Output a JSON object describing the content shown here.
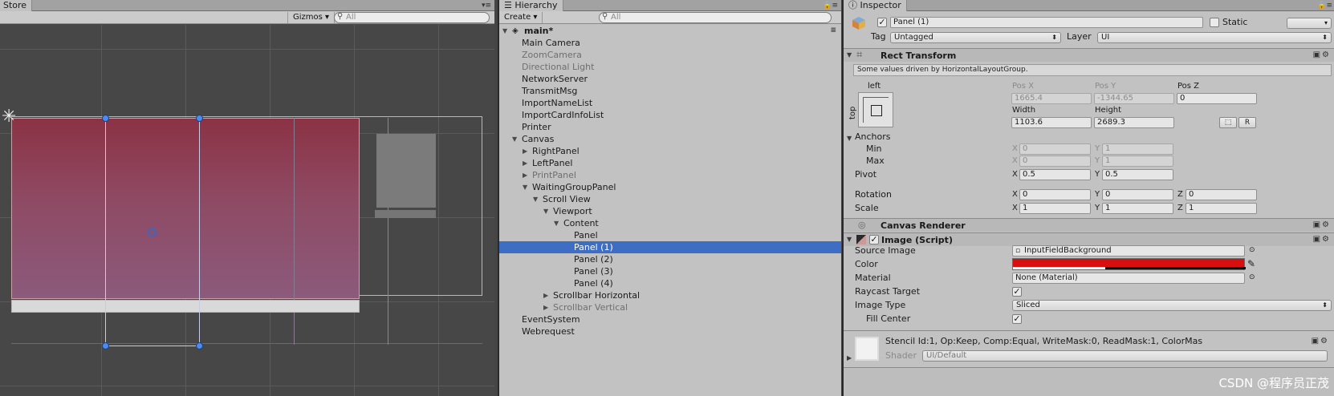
{
  "scene": {
    "tab_label": "Store",
    "gizmos_label": "Gizmos ▾",
    "search_placeholder": "All"
  },
  "hierarchy": {
    "tab_label": "Hierarchy",
    "create_label": "Create ▾",
    "search_placeholder": "All",
    "scene_name": "main*",
    "items": [
      {
        "label": "Main Camera",
        "depth": 0,
        "arrow": "",
        "dim": false,
        "selected": false
      },
      {
        "label": "ZoomCamera",
        "depth": 0,
        "arrow": "",
        "dim": true,
        "selected": false
      },
      {
        "label": "Directional Light",
        "depth": 0,
        "arrow": "",
        "dim": true,
        "selected": false
      },
      {
        "label": "NetworkServer",
        "depth": 0,
        "arrow": "",
        "dim": false,
        "selected": false
      },
      {
        "label": "TransmitMsg",
        "depth": 0,
        "arrow": "",
        "dim": false,
        "selected": false
      },
      {
        "label": "ImportNameList",
        "depth": 0,
        "arrow": "",
        "dim": false,
        "selected": false
      },
      {
        "label": "ImportCardInfoList",
        "depth": 0,
        "arrow": "",
        "dim": false,
        "selected": false
      },
      {
        "label": "Printer",
        "depth": 0,
        "arrow": "",
        "dim": false,
        "selected": false
      },
      {
        "label": "Canvas",
        "depth": 0,
        "arrow": "▼",
        "dim": false,
        "selected": false
      },
      {
        "label": "RightPanel",
        "depth": 1,
        "arrow": "▶",
        "dim": false,
        "selected": false
      },
      {
        "label": "LeftPanel",
        "depth": 1,
        "arrow": "▶",
        "dim": false,
        "selected": false
      },
      {
        "label": "PrintPanel",
        "depth": 1,
        "arrow": "▶",
        "dim": true,
        "selected": false
      },
      {
        "label": "WaitingGroupPanel",
        "depth": 1,
        "arrow": "▼",
        "dim": false,
        "selected": false
      },
      {
        "label": "Scroll View",
        "depth": 2,
        "arrow": "▼",
        "dim": false,
        "selected": false
      },
      {
        "label": "Viewport",
        "depth": 3,
        "arrow": "▼",
        "dim": false,
        "selected": false
      },
      {
        "label": "Content",
        "depth": 4,
        "arrow": "▼",
        "dim": false,
        "selected": false
      },
      {
        "label": "Panel",
        "depth": 5,
        "arrow": "",
        "dim": false,
        "selected": false
      },
      {
        "label": "Panel (1)",
        "depth": 5,
        "arrow": "",
        "dim": false,
        "selected": true
      },
      {
        "label": "Panel (2)",
        "depth": 5,
        "arrow": "",
        "dim": false,
        "selected": false
      },
      {
        "label": "Panel (3)",
        "depth": 5,
        "arrow": "",
        "dim": false,
        "selected": false
      },
      {
        "label": "Panel (4)",
        "depth": 5,
        "arrow": "",
        "dim": false,
        "selected": false
      },
      {
        "label": "Scrollbar Horizontal",
        "depth": 3,
        "arrow": "▶",
        "dim": false,
        "selected": false
      },
      {
        "label": "Scrollbar Vertical",
        "depth": 3,
        "arrow": "▶",
        "dim": true,
        "selected": false
      },
      {
        "label": "EventSystem",
        "depth": 0,
        "arrow": "",
        "dim": false,
        "selected": false
      },
      {
        "label": "Webrequest",
        "depth": 0,
        "arrow": "",
        "dim": false,
        "selected": false
      }
    ]
  },
  "inspector": {
    "tab_label": "Inspector",
    "object_name": "Panel (1)",
    "static_label": "Static",
    "tag_label": "Tag",
    "tag_value": "Untagged",
    "layer_label": "Layer",
    "layer_value": "UI",
    "rect_transform": {
      "title": "Rect Transform",
      "info": "Some values driven by HorizontalLayoutGroup.",
      "anchor_h_label": "left",
      "anchor_v_label": "top",
      "pos_x_label": "Pos X",
      "pos_y_label": "Pos Y",
      "pos_z_label": "Pos Z",
      "pos_x": "1665.4",
      "pos_y": "-1344.65",
      "pos_z": "0",
      "width_label": "Width",
      "height_label": "Height",
      "width": "1103.6",
      "height": "2689.3",
      "r_button": "R",
      "anchors_label": "Anchors",
      "min_label": "Min",
      "max_label": "Max",
      "anchor_min_x": "0",
      "anchor_min_y": "1",
      "anchor_max_x": "0",
      "anchor_max_y": "1",
      "pivot_label": "Pivot",
      "pivot_x": "0.5",
      "pivot_y": "0.5",
      "rotation_label": "Rotation",
      "rot_x": "0",
      "rot_y": "0",
      "rot_z": "0",
      "scale_label": "Scale",
      "scale_x": "1",
      "scale_y": "1",
      "scale_z": "1",
      "x_axis": "X",
      "y_axis": "Y",
      "z_axis": "Z"
    },
    "canvas_renderer": {
      "title": "Canvas Renderer"
    },
    "image": {
      "title": "Image (Script)",
      "source_image_label": "Source Image",
      "source_image_value": "InputFieldBackground",
      "color_label": "Color",
      "color_value": "#d90f0f",
      "material_label": "Material",
      "material_value": "None (Material)",
      "raycast_label": "Raycast Target",
      "image_type_label": "Image Type",
      "image_type_value": "Sliced",
      "fill_center_label": "Fill Center"
    },
    "material_preview": {
      "name": "Stencil Id:1, Op:Keep, Comp:Equal, WriteMask:0, ReadMask:1, ColorMas",
      "shader_label": "Shader",
      "shader_value": "UI/Default"
    }
  },
  "watermark": "CSDN @程序员正茂"
}
